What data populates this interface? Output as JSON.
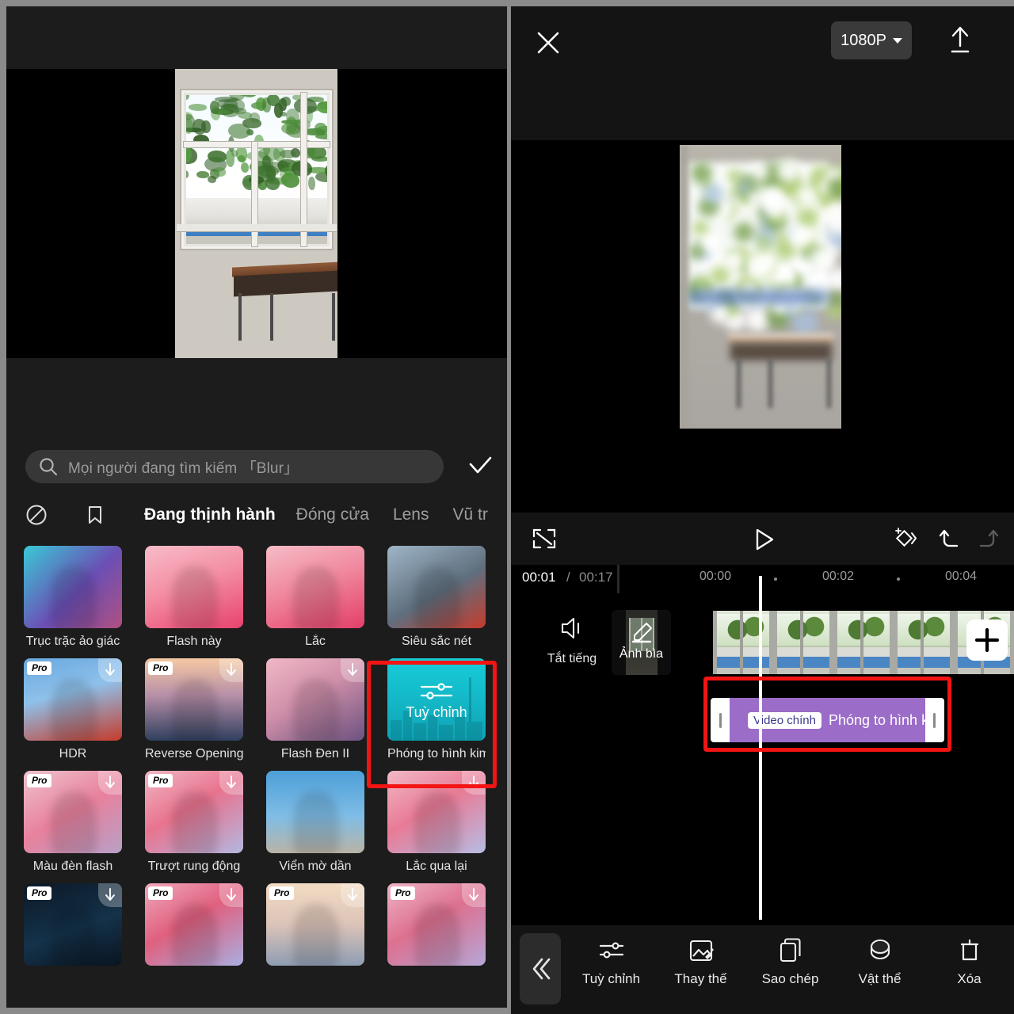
{
  "app": {
    "accent_purple": "#9b6cc8",
    "accent_cyan": "#16c7d4",
    "highlight_red": "#f31414"
  },
  "left_panel": {
    "search": {
      "placeholder": "Mọi người đang tìm kiếm 「Blur」",
      "search_icon": "search-icon",
      "confirm_icon": "check-icon"
    },
    "tabs": {
      "none_icon": "no-effect-icon",
      "bookmark_icon": "bookmark-icon",
      "items": [
        {
          "label": "Đang thịnh hành",
          "active": true
        },
        {
          "label": "Đóng cửa",
          "active": false
        },
        {
          "label": "Lens",
          "active": false
        },
        {
          "label": "Vũ tr",
          "active": false
        }
      ]
    },
    "effects": [
      {
        "label": "Trục trặc ảo giác",
        "pro": false,
        "download": false,
        "selected": false
      },
      {
        "label": "Flash này",
        "pro": false,
        "download": false,
        "selected": false
      },
      {
        "label": "Lắc",
        "pro": false,
        "download": false,
        "selected": false
      },
      {
        "label": "Siêu sắc nét",
        "pro": false,
        "download": false,
        "selected": false
      },
      {
        "label": "HDR",
        "pro": true,
        "download": true,
        "selected": false
      },
      {
        "label": "Reverse Opening",
        "pro": true,
        "download": true,
        "selected": false
      },
      {
        "label": "Flash Đen II",
        "pro": false,
        "download": true,
        "selected": false
      },
      {
        "label": "Phóng to hình kim",
        "pro": false,
        "download": false,
        "selected": true,
        "card_title": "Tuỳ chỉnh",
        "card_icon": "sliders-icon"
      },
      {
        "label": "Màu đèn flash",
        "pro": true,
        "download": true,
        "selected": false
      },
      {
        "label": "Trượt rung động",
        "pro": true,
        "download": true,
        "selected": false
      },
      {
        "label": "Viển mờ dần",
        "pro": false,
        "download": false,
        "selected": false
      },
      {
        "label": "Lắc qua lại",
        "pro": false,
        "download": true,
        "selected": false
      },
      {
        "label": "",
        "pro": true,
        "download": true,
        "selected": false
      },
      {
        "label": "",
        "pro": true,
        "download": true,
        "selected": false
      },
      {
        "label": "",
        "pro": true,
        "download": true,
        "selected": false
      },
      {
        "label": "",
        "pro": true,
        "download": true,
        "selected": false
      }
    ],
    "pro_badge_text": "Pro"
  },
  "right_panel": {
    "topbar": {
      "close_icon": "close-icon",
      "resolution": "1080P",
      "resolution_caret": "chevron-down-icon",
      "export_icon": "upload-icon"
    },
    "player": {
      "fullscreen_icon": "expand-icon",
      "play_icon": "play-icon",
      "keyframe_icon": "add-keyframe-icon",
      "undo_icon": "undo-icon",
      "redo_icon": "redo-icon"
    },
    "timeline": {
      "current_time": "00:01",
      "separator": "/",
      "total_time": "00:17",
      "ruler_labels": [
        "00:00",
        "00:02",
        "00:04"
      ],
      "mute": {
        "label": "Tắt tiếng",
        "icon": "speaker-icon"
      },
      "cover": {
        "label": "Ảnh bìa",
        "icon": "pencil-icon"
      },
      "add_clip_icon": "plus-icon",
      "effect_clip": {
        "badge": "Video chính",
        "name": "Phóng to hình k"
      }
    },
    "toolbar": {
      "collapse_icon": "chevron-double-left-icon",
      "items": [
        {
          "label": "Tuỳ chỉnh",
          "icon": "sliders-icon"
        },
        {
          "label": "Thay thế",
          "icon": "replace-image-icon"
        },
        {
          "label": "Sao chép",
          "icon": "copy-icon"
        },
        {
          "label": "Vật thể",
          "icon": "object-icon"
        },
        {
          "label": "Xóa",
          "icon": "trash-icon"
        }
      ]
    }
  }
}
